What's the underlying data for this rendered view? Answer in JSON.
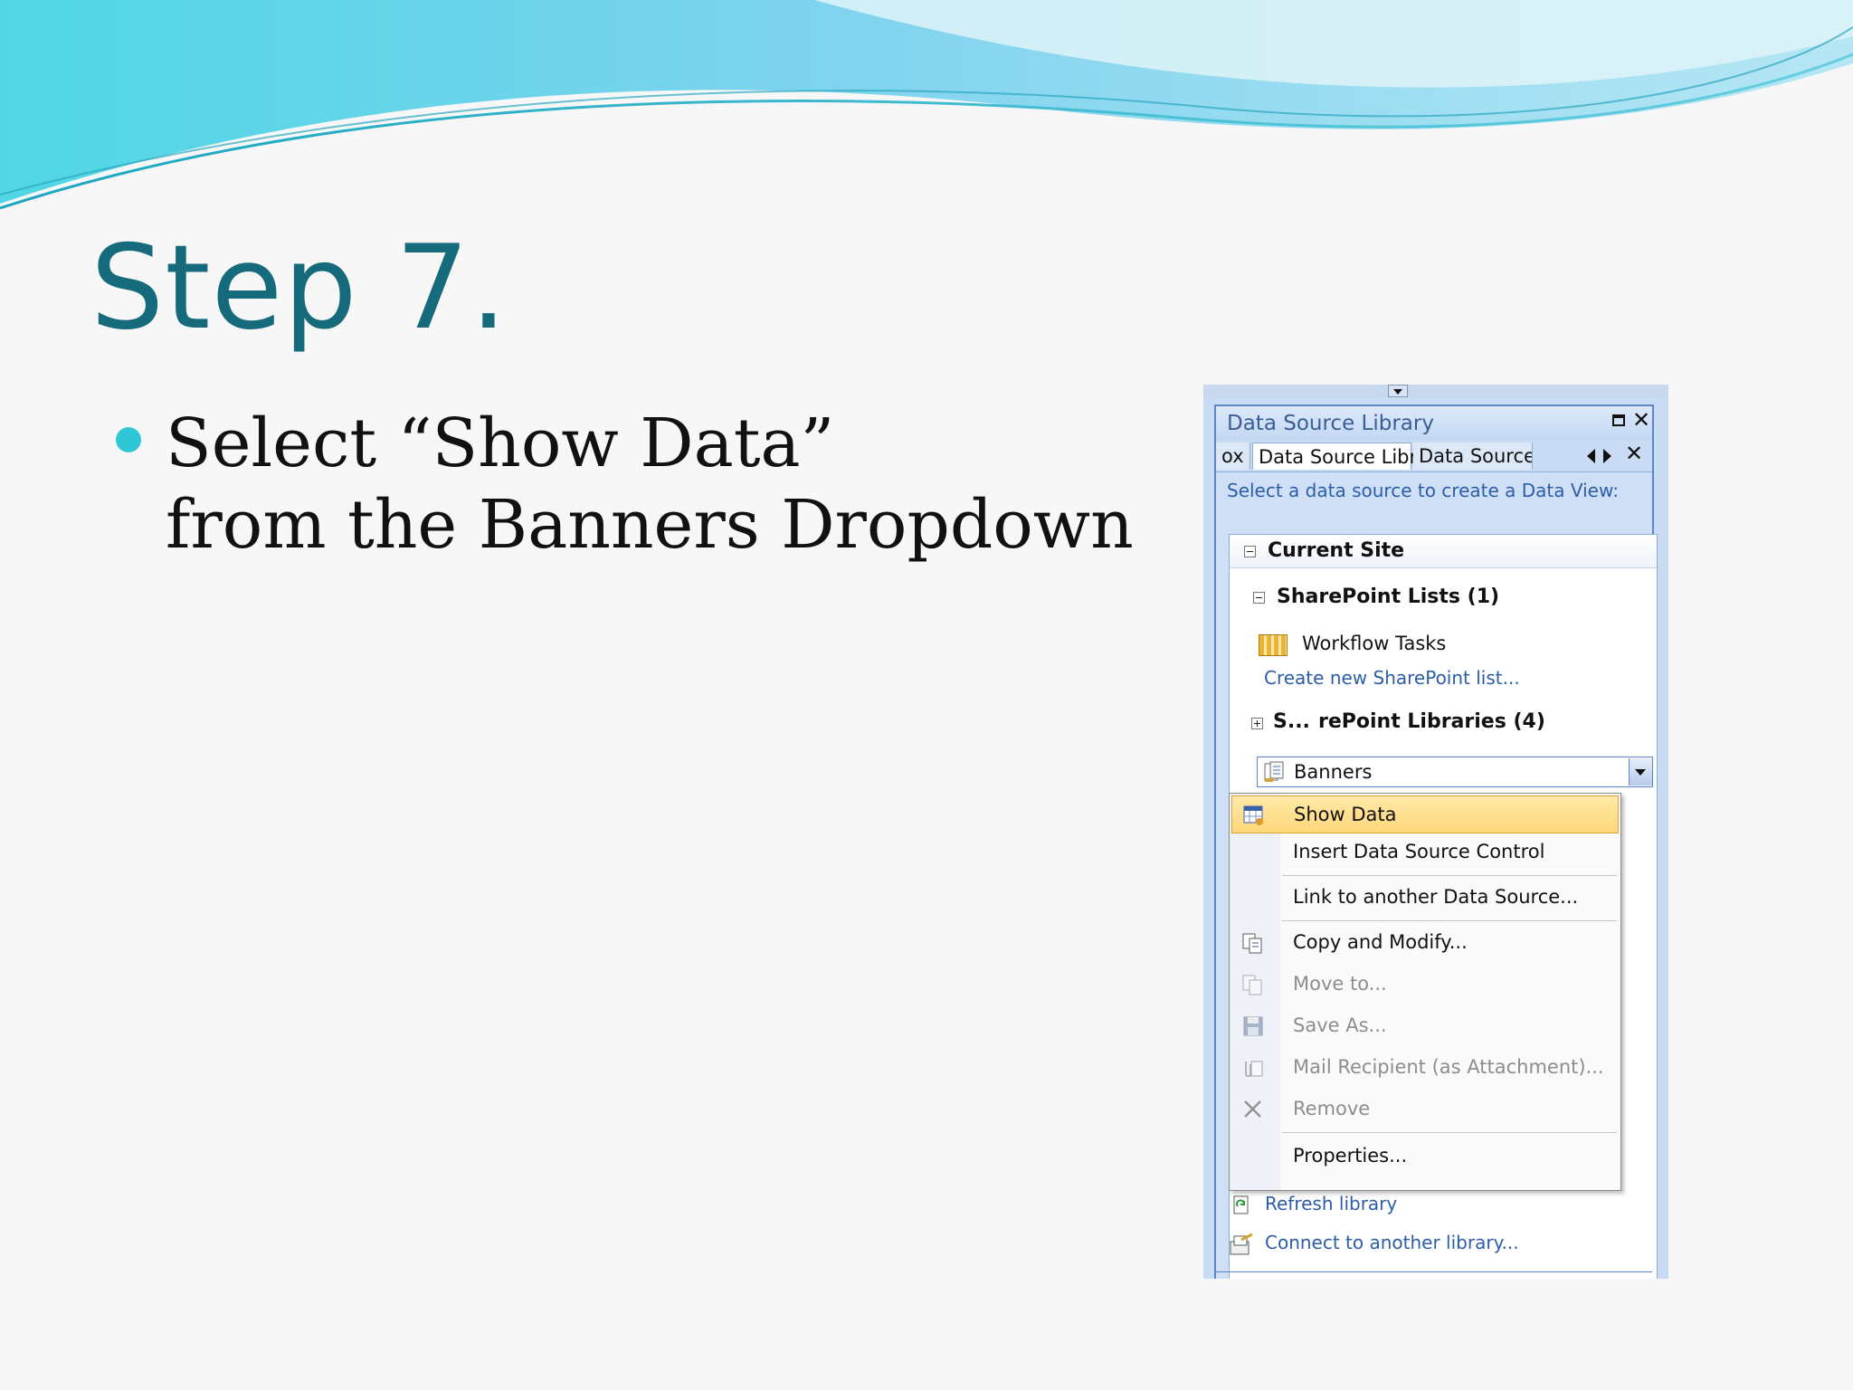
{
  "slide": {
    "title": "Step 7.",
    "bullet_line1": "Select “Show Data”",
    "bullet_line2": "from the Banners Dropdown"
  },
  "window": {
    "title": "Data Source Library",
    "tabs": [
      "ox",
      "Data Source Library",
      "Data Source"
    ],
    "prompt": "Select a data source to create a Data View:"
  },
  "tree": {
    "current_site": "Current Site",
    "sharepoint_lists": "SharePoint Lists (1)",
    "workflow_tasks": "Workflow Tasks",
    "create_list_link": "Create new SharePoint list...",
    "libraries_left": "S...",
    "libraries_right": "rePoint Libraries (4)",
    "combo_value": "Banners"
  },
  "menu": {
    "items": [
      {
        "label": "Show Data",
        "highlighted": true,
        "disabled": false
      },
      {
        "label": "Insert Data Source Control",
        "disabled": false
      },
      {
        "label": "Link to another Data Source...",
        "disabled": false
      },
      {
        "label": "Copy and Modify...",
        "disabled": false
      },
      {
        "label": "Move to...",
        "disabled": true
      },
      {
        "label": "Save As...",
        "disabled": true
      },
      {
        "label": "Mail Recipient (as Attachment)...",
        "disabled": true
      },
      {
        "label": "Remove",
        "disabled": true
      },
      {
        "label": "Properties...",
        "disabled": false
      }
    ]
  },
  "footer": {
    "refresh": "Refresh library",
    "connect": "Connect to another library..."
  },
  "colors": {
    "title": "#156a7c",
    "bullet": "#2fc6d6",
    "link": "#2c5da8",
    "highlight": "#ffd779"
  }
}
